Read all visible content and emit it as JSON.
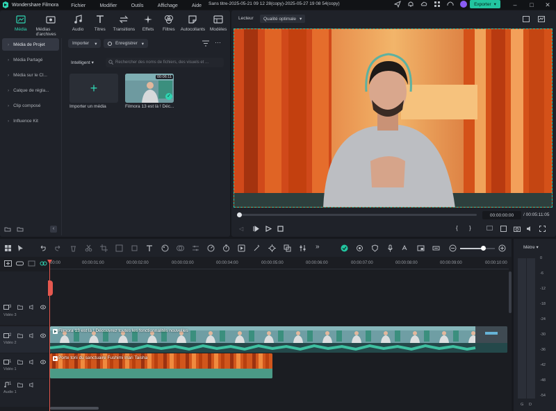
{
  "app": {
    "name": "Wondershare Filmora",
    "menu": [
      "Fichier",
      "Modifier",
      "Outils",
      "Affichage",
      "Aide"
    ],
    "document_title": "Sans titre-2025-05-21 09 12 28(copy)-2025-05-27 19 08 54(copy)",
    "export_label": "Exporter"
  },
  "tools": [
    {
      "label": "Média",
      "icon": "media-icon"
    },
    {
      "label": "Médias d'archives",
      "icon": "stock-media-icon"
    },
    {
      "label": "Audio",
      "icon": "music-note-icon"
    },
    {
      "label": "Titres",
      "icon": "text-icon"
    },
    {
      "label": "Transitions",
      "icon": "transition-icon"
    },
    {
      "label": "Effets",
      "icon": "sparkle-icon"
    },
    {
      "label": "Filtres",
      "icon": "filter-icon"
    },
    {
      "label": "Autocollants",
      "icon": "sticker-icon"
    },
    {
      "label": "Modèles",
      "icon": "template-icon"
    }
  ],
  "sidebar": {
    "items": [
      {
        "label": "Média de Projet",
        "active": true
      },
      {
        "label": "Média Partagé"
      },
      {
        "label": "Média sur le Cl..."
      },
      {
        "label": "Calque de régla..."
      },
      {
        "label": "Clip composé"
      },
      {
        "label": "Influence Kit"
      }
    ]
  },
  "media": {
    "import_button": "Importer",
    "record_button": "Enregistrer",
    "sort_label": "Intelligent",
    "search_placeholder": "Rechercher des noms de fichiers, des visuels et ...",
    "import_tile_label": "Importer un média",
    "clip_name": "Filmora 13 est là ! Déc...",
    "clip_duration": "00:06:11"
  },
  "player": {
    "tab_label": "Lecteur",
    "quality": "Qualité optimale",
    "current_time": "00:00:00:00",
    "total_time": "/ 00:05:11:05"
  },
  "timeline": {
    "ruler": [
      "00:00",
      "00:00:01:00",
      "00:00:02:00",
      "00:00:03:00",
      "00:00:04:00",
      "00:00:05:00",
      "00:00:06:00",
      "00:00:07:00",
      "00:00:08:00",
      "00:00:09:00",
      "00:00:10:00"
    ],
    "tracks": [
      {
        "num": "3",
        "label": "Vidéo 3"
      },
      {
        "num": "2",
        "label": "Vidéo 2"
      },
      {
        "num": "1",
        "label": "Vidéo 1"
      },
      {
        "num": "1",
        "label": "Audio 1"
      }
    ],
    "clip_v2_title": "Filmora 13 est là ! Découvrez toutes les fonctionnalités nouvelles",
    "clip_v1_title": "Porte torii du sanctuaire Fushimi Inari Taisha"
  },
  "meter": {
    "title": "Mètre",
    "scale": [
      "0",
      "-6",
      "-12",
      "-18",
      "-24",
      "-30",
      "-36",
      "-42",
      "-48",
      "-54"
    ],
    "channels": [
      "G",
      "D"
    ]
  },
  "colors": {
    "accent": "#22c5a0",
    "playhead": "#e5584f"
  }
}
